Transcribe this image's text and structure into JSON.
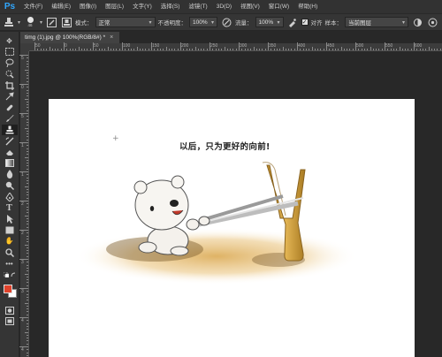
{
  "app": {
    "logo": "Ps"
  },
  "menu": [
    "文件(F)",
    "编辑(E)",
    "图像(I)",
    "图层(L)",
    "文字(Y)",
    "选择(S)",
    "滤镜(T)",
    "3D(D)",
    "视图(V)",
    "窗口(W)",
    "帮助(H)"
  ],
  "options": {
    "brush_size": "46",
    "mode_label": "模式：",
    "mode_value": "正常",
    "opacity_label": "不透明度：",
    "opacity_value": "100%",
    "flow_label": "流量：",
    "flow_value": "100%",
    "aligned_label": "对齐",
    "sample_label": "样本：",
    "sample_value": "当前图层"
  },
  "document": {
    "tab_title": "timg (1).jpg @ 100%(RGB/8#) *",
    "caption": "以后，只为更好的向前!",
    "crosshair": "+"
  },
  "ruler": {
    "top_ticks": [
      "50",
      "0",
      "50",
      "100",
      "150",
      "200",
      "250",
      "300",
      "350",
      "400",
      "450",
      "500",
      "550",
      "600",
      "650"
    ],
    "left_ticks": [
      "5",
      "0",
      "5",
      "1",
      "1",
      "2",
      "2",
      "3",
      "3",
      "4",
      "4"
    ]
  },
  "colors": {
    "foreground": "#e0422b",
    "background": "#ffffff",
    "accent": "#31a8ff"
  },
  "tools": [
    "move-tool",
    "marquee-tool",
    "lasso-tool",
    "quick-select-tool",
    "crop-tool",
    "eyedropper-tool",
    "healing-brush-tool",
    "brush-tool",
    "clone-stamp-tool",
    "history-brush-tool",
    "eraser-tool",
    "gradient-tool",
    "blur-tool",
    "dodge-tool",
    "pen-tool",
    "type-tool",
    "path-select-tool",
    "rectangle-tool",
    "hand-tool",
    "zoom-tool",
    "more-tools",
    "default-colors-tool",
    "swap-colors-tool"
  ]
}
